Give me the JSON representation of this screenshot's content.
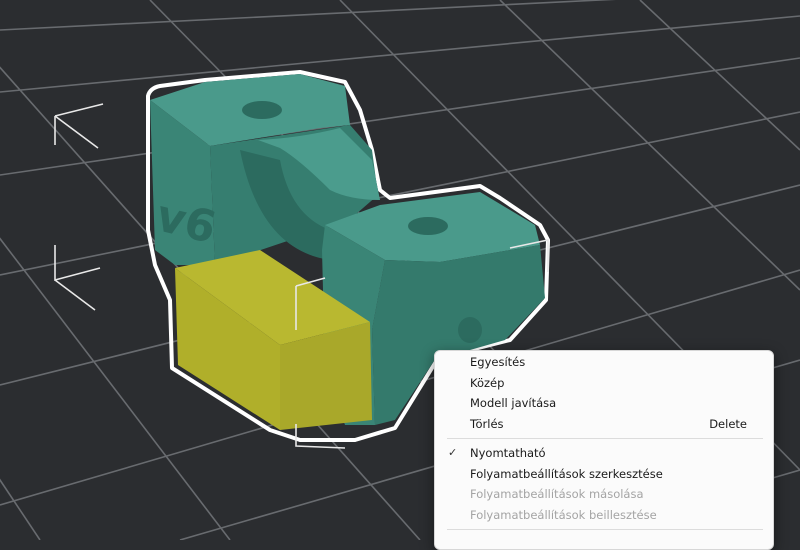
{
  "scene": {
    "model_part_colors": {
      "body": "#3d8a7c",
      "body_dark": "#2f6e62",
      "modifier": "#b4b42a"
    },
    "selection_color": "#ffffff",
    "grid_color": "#6a6d70",
    "background_color": "#2b2d30"
  },
  "context_menu": {
    "items": [
      {
        "label": "Egyesítés",
        "enabled": true
      },
      {
        "label": "Közép",
        "enabled": true
      },
      {
        "label": "Modell javítása",
        "enabled": true
      },
      {
        "label": "Törlés",
        "shortcut": "Delete",
        "enabled": true
      },
      {
        "label": "Nyomtatható",
        "checked": true,
        "enabled": true
      },
      {
        "label": "Folyamatbeállítások szerkesztése",
        "enabled": true
      },
      {
        "label": "Folyamatbeállítások másolása",
        "enabled": false
      },
      {
        "label": "Folyamatbeállítások beillesztése",
        "enabled": false
      }
    ],
    "check_glyph": "✓"
  }
}
